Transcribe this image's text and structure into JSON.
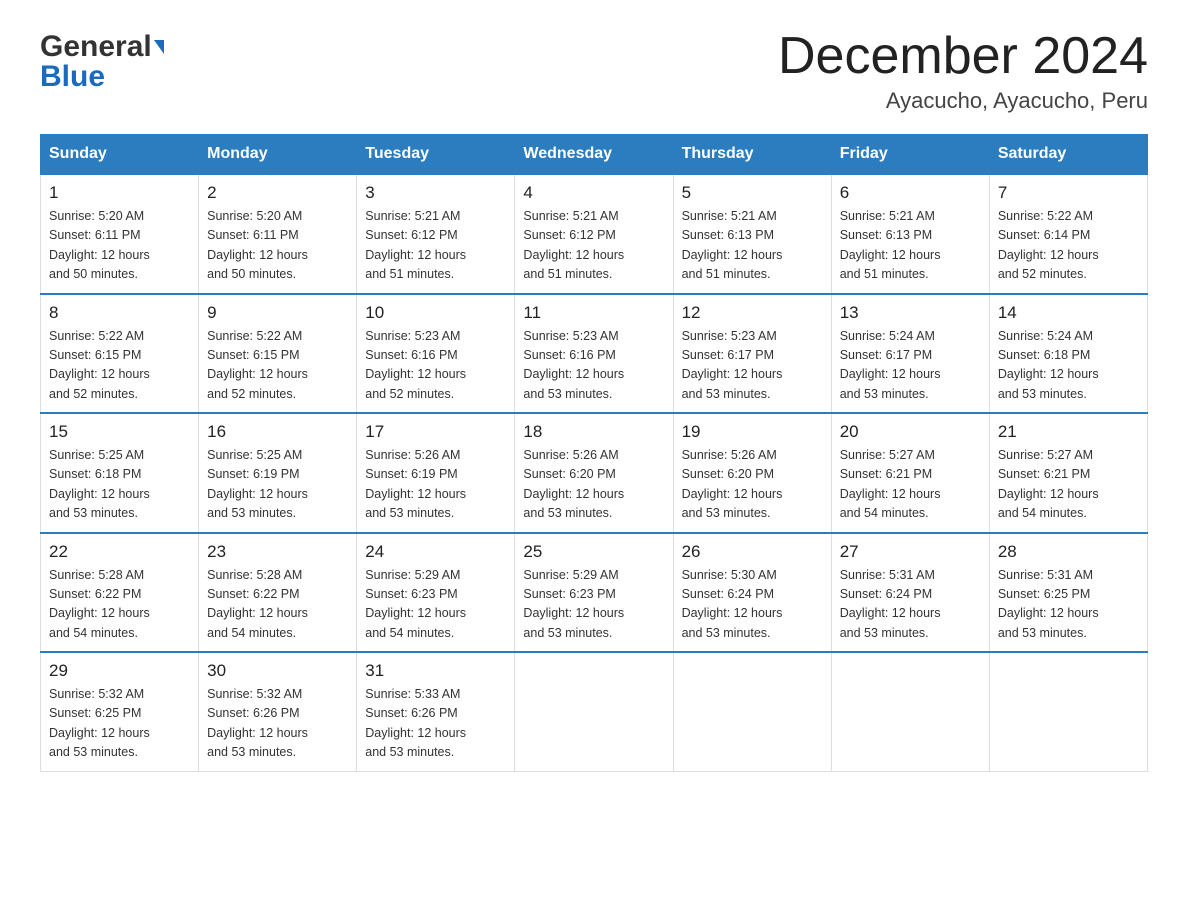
{
  "header": {
    "logo_line1": "General",
    "logo_line2": "Blue",
    "month_title": "December 2024",
    "location": "Ayacucho, Ayacucho, Peru"
  },
  "weekdays": [
    "Sunday",
    "Monday",
    "Tuesday",
    "Wednesday",
    "Thursday",
    "Friday",
    "Saturday"
  ],
  "weeks": [
    [
      {
        "day": "1",
        "info": "Sunrise: 5:20 AM\nSunset: 6:11 PM\nDaylight: 12 hours\nand 50 minutes."
      },
      {
        "day": "2",
        "info": "Sunrise: 5:20 AM\nSunset: 6:11 PM\nDaylight: 12 hours\nand 50 minutes."
      },
      {
        "day": "3",
        "info": "Sunrise: 5:21 AM\nSunset: 6:12 PM\nDaylight: 12 hours\nand 51 minutes."
      },
      {
        "day": "4",
        "info": "Sunrise: 5:21 AM\nSunset: 6:12 PM\nDaylight: 12 hours\nand 51 minutes."
      },
      {
        "day": "5",
        "info": "Sunrise: 5:21 AM\nSunset: 6:13 PM\nDaylight: 12 hours\nand 51 minutes."
      },
      {
        "day": "6",
        "info": "Sunrise: 5:21 AM\nSunset: 6:13 PM\nDaylight: 12 hours\nand 51 minutes."
      },
      {
        "day": "7",
        "info": "Sunrise: 5:22 AM\nSunset: 6:14 PM\nDaylight: 12 hours\nand 52 minutes."
      }
    ],
    [
      {
        "day": "8",
        "info": "Sunrise: 5:22 AM\nSunset: 6:15 PM\nDaylight: 12 hours\nand 52 minutes."
      },
      {
        "day": "9",
        "info": "Sunrise: 5:22 AM\nSunset: 6:15 PM\nDaylight: 12 hours\nand 52 minutes."
      },
      {
        "day": "10",
        "info": "Sunrise: 5:23 AM\nSunset: 6:16 PM\nDaylight: 12 hours\nand 52 minutes."
      },
      {
        "day": "11",
        "info": "Sunrise: 5:23 AM\nSunset: 6:16 PM\nDaylight: 12 hours\nand 53 minutes."
      },
      {
        "day": "12",
        "info": "Sunrise: 5:23 AM\nSunset: 6:17 PM\nDaylight: 12 hours\nand 53 minutes."
      },
      {
        "day": "13",
        "info": "Sunrise: 5:24 AM\nSunset: 6:17 PM\nDaylight: 12 hours\nand 53 minutes."
      },
      {
        "day": "14",
        "info": "Sunrise: 5:24 AM\nSunset: 6:18 PM\nDaylight: 12 hours\nand 53 minutes."
      }
    ],
    [
      {
        "day": "15",
        "info": "Sunrise: 5:25 AM\nSunset: 6:18 PM\nDaylight: 12 hours\nand 53 minutes."
      },
      {
        "day": "16",
        "info": "Sunrise: 5:25 AM\nSunset: 6:19 PM\nDaylight: 12 hours\nand 53 minutes."
      },
      {
        "day": "17",
        "info": "Sunrise: 5:26 AM\nSunset: 6:19 PM\nDaylight: 12 hours\nand 53 minutes."
      },
      {
        "day": "18",
        "info": "Sunrise: 5:26 AM\nSunset: 6:20 PM\nDaylight: 12 hours\nand 53 minutes."
      },
      {
        "day": "19",
        "info": "Sunrise: 5:26 AM\nSunset: 6:20 PM\nDaylight: 12 hours\nand 53 minutes."
      },
      {
        "day": "20",
        "info": "Sunrise: 5:27 AM\nSunset: 6:21 PM\nDaylight: 12 hours\nand 54 minutes."
      },
      {
        "day": "21",
        "info": "Sunrise: 5:27 AM\nSunset: 6:21 PM\nDaylight: 12 hours\nand 54 minutes."
      }
    ],
    [
      {
        "day": "22",
        "info": "Sunrise: 5:28 AM\nSunset: 6:22 PM\nDaylight: 12 hours\nand 54 minutes."
      },
      {
        "day": "23",
        "info": "Sunrise: 5:28 AM\nSunset: 6:22 PM\nDaylight: 12 hours\nand 54 minutes."
      },
      {
        "day": "24",
        "info": "Sunrise: 5:29 AM\nSunset: 6:23 PM\nDaylight: 12 hours\nand 54 minutes."
      },
      {
        "day": "25",
        "info": "Sunrise: 5:29 AM\nSunset: 6:23 PM\nDaylight: 12 hours\nand 53 minutes."
      },
      {
        "day": "26",
        "info": "Sunrise: 5:30 AM\nSunset: 6:24 PM\nDaylight: 12 hours\nand 53 minutes."
      },
      {
        "day": "27",
        "info": "Sunrise: 5:31 AM\nSunset: 6:24 PM\nDaylight: 12 hours\nand 53 minutes."
      },
      {
        "day": "28",
        "info": "Sunrise: 5:31 AM\nSunset: 6:25 PM\nDaylight: 12 hours\nand 53 minutes."
      }
    ],
    [
      {
        "day": "29",
        "info": "Sunrise: 5:32 AM\nSunset: 6:25 PM\nDaylight: 12 hours\nand 53 minutes."
      },
      {
        "day": "30",
        "info": "Sunrise: 5:32 AM\nSunset: 6:26 PM\nDaylight: 12 hours\nand 53 minutes."
      },
      {
        "day": "31",
        "info": "Sunrise: 5:33 AM\nSunset: 6:26 PM\nDaylight: 12 hours\nand 53 minutes."
      },
      {
        "day": "",
        "info": ""
      },
      {
        "day": "",
        "info": ""
      },
      {
        "day": "",
        "info": ""
      },
      {
        "day": "",
        "info": ""
      }
    ]
  ]
}
